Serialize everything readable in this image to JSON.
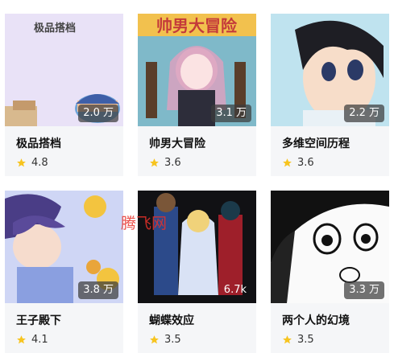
{
  "cards": [
    {
      "title": "极品搭档",
      "rating": "4.8",
      "views": "2.0 万",
      "cover_text": "极品搭档"
    },
    {
      "title": "帅男大冒险",
      "rating": "3.6",
      "views": "3.1 万",
      "cover_text": "帅男大冒险"
    },
    {
      "title": "多维空间历程",
      "rating": "3.6",
      "views": "2.2 万"
    },
    {
      "title": "王子殿下",
      "rating": "4.1",
      "views": "3.8 万"
    },
    {
      "title": "蝴蝶效应",
      "rating": "3.5",
      "views": "6.7k"
    },
    {
      "title": "两个人的幻境",
      "rating": "3.5",
      "views": "3.3 万"
    }
  ],
  "watermark": "腾飞网",
  "colors": {
    "star": "#f7c41f",
    "card_bg": "#f5f6f8",
    "badge_bg": "#3c3c3c"
  }
}
